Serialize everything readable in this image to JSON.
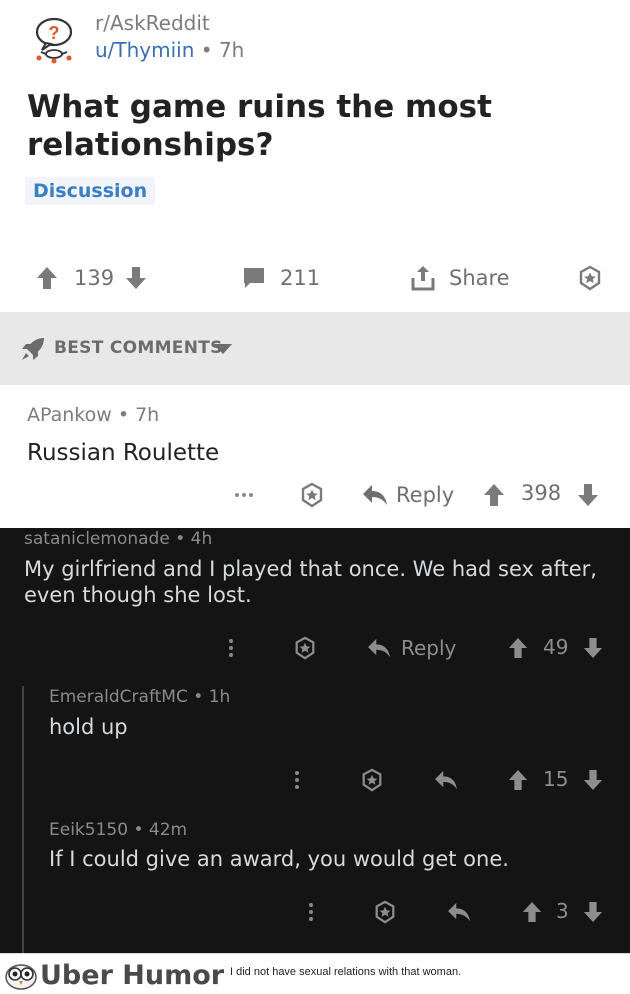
{
  "post": {
    "subreddit": "r/AskReddit",
    "author": "u/Thymiin",
    "separator": "•",
    "age": "7h",
    "title": "What game ruins the most relationships?",
    "flair": "Discussion",
    "upvotes": "139",
    "comments": "211",
    "share_label": "Share"
  },
  "sort": {
    "label": "BEST COMMENTS"
  },
  "comments": [
    {
      "author": "APankow",
      "age": "7h",
      "body": "Russian Roulette",
      "reply_label": "Reply",
      "score": "398"
    },
    {
      "author": "sataniclemonade",
      "age": "4h",
      "body_line1": "My girlfriend and I played that once. We had sex after,",
      "body_line2": "even though she lost.",
      "reply_label": "Reply",
      "score": "49"
    },
    {
      "author": "EmeraldCraftMC",
      "age": "1h",
      "body": "hold up",
      "score": "15"
    },
    {
      "author": "Eeik5150",
      "age": "42m",
      "body": "If I could give an award, you would get one.",
      "score": "3"
    }
  ],
  "footer": {
    "brand": "Uber Humor",
    "tagline": "I did not have sexual relations with that woman."
  },
  "colors": {
    "accent_blue": "#3a7fc6",
    "dark_bg": "#141414",
    "sortbar_bg": "#e8e8e9"
  }
}
